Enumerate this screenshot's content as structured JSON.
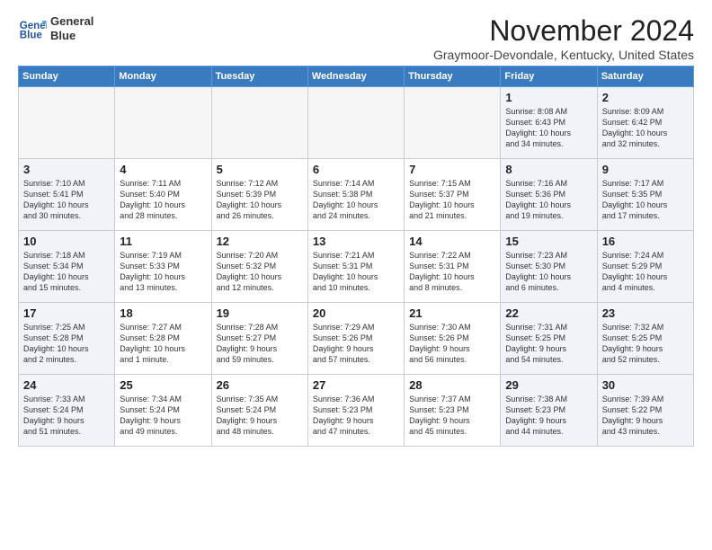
{
  "header": {
    "logo_line1": "General",
    "logo_line2": "Blue",
    "month_title": "November 2024",
    "subtitle": "Graymoor-Devondale, Kentucky, United States"
  },
  "weekdays": [
    "Sunday",
    "Monday",
    "Tuesday",
    "Wednesday",
    "Thursday",
    "Friday",
    "Saturday"
  ],
  "weeks": [
    [
      {
        "day": "",
        "info": "",
        "empty": true
      },
      {
        "day": "",
        "info": "",
        "empty": true
      },
      {
        "day": "",
        "info": "",
        "empty": true
      },
      {
        "day": "",
        "info": "",
        "empty": true
      },
      {
        "day": "",
        "info": "",
        "empty": true
      },
      {
        "day": "1",
        "info": "Sunrise: 8:08 AM\nSunset: 6:43 PM\nDaylight: 10 hours\nand 34 minutes.",
        "empty": false,
        "weekend": true
      },
      {
        "day": "2",
        "info": "Sunrise: 8:09 AM\nSunset: 6:42 PM\nDaylight: 10 hours\nand 32 minutes.",
        "empty": false,
        "weekend": true
      }
    ],
    [
      {
        "day": "3",
        "info": "Sunrise: 7:10 AM\nSunset: 5:41 PM\nDaylight: 10 hours\nand 30 minutes.",
        "empty": false,
        "weekend": true
      },
      {
        "day": "4",
        "info": "Sunrise: 7:11 AM\nSunset: 5:40 PM\nDaylight: 10 hours\nand 28 minutes.",
        "empty": false
      },
      {
        "day": "5",
        "info": "Sunrise: 7:12 AM\nSunset: 5:39 PM\nDaylight: 10 hours\nand 26 minutes.",
        "empty": false
      },
      {
        "day": "6",
        "info": "Sunrise: 7:14 AM\nSunset: 5:38 PM\nDaylight: 10 hours\nand 24 minutes.",
        "empty": false
      },
      {
        "day": "7",
        "info": "Sunrise: 7:15 AM\nSunset: 5:37 PM\nDaylight: 10 hours\nand 21 minutes.",
        "empty": false
      },
      {
        "day": "8",
        "info": "Sunrise: 7:16 AM\nSunset: 5:36 PM\nDaylight: 10 hours\nand 19 minutes.",
        "empty": false,
        "weekend": true
      },
      {
        "day": "9",
        "info": "Sunrise: 7:17 AM\nSunset: 5:35 PM\nDaylight: 10 hours\nand 17 minutes.",
        "empty": false,
        "weekend": true
      }
    ],
    [
      {
        "day": "10",
        "info": "Sunrise: 7:18 AM\nSunset: 5:34 PM\nDaylight: 10 hours\nand 15 minutes.",
        "empty": false,
        "weekend": true
      },
      {
        "day": "11",
        "info": "Sunrise: 7:19 AM\nSunset: 5:33 PM\nDaylight: 10 hours\nand 13 minutes.",
        "empty": false
      },
      {
        "day": "12",
        "info": "Sunrise: 7:20 AM\nSunset: 5:32 PM\nDaylight: 10 hours\nand 12 minutes.",
        "empty": false
      },
      {
        "day": "13",
        "info": "Sunrise: 7:21 AM\nSunset: 5:31 PM\nDaylight: 10 hours\nand 10 minutes.",
        "empty": false
      },
      {
        "day": "14",
        "info": "Sunrise: 7:22 AM\nSunset: 5:31 PM\nDaylight: 10 hours\nand 8 minutes.",
        "empty": false
      },
      {
        "day": "15",
        "info": "Sunrise: 7:23 AM\nSunset: 5:30 PM\nDaylight: 10 hours\nand 6 minutes.",
        "empty": false,
        "weekend": true
      },
      {
        "day": "16",
        "info": "Sunrise: 7:24 AM\nSunset: 5:29 PM\nDaylight: 10 hours\nand 4 minutes.",
        "empty": false,
        "weekend": true
      }
    ],
    [
      {
        "day": "17",
        "info": "Sunrise: 7:25 AM\nSunset: 5:28 PM\nDaylight: 10 hours\nand 2 minutes.",
        "empty": false,
        "weekend": true
      },
      {
        "day": "18",
        "info": "Sunrise: 7:27 AM\nSunset: 5:28 PM\nDaylight: 10 hours\nand 1 minute.",
        "empty": false
      },
      {
        "day": "19",
        "info": "Sunrise: 7:28 AM\nSunset: 5:27 PM\nDaylight: 9 hours\nand 59 minutes.",
        "empty": false
      },
      {
        "day": "20",
        "info": "Sunrise: 7:29 AM\nSunset: 5:26 PM\nDaylight: 9 hours\nand 57 minutes.",
        "empty": false
      },
      {
        "day": "21",
        "info": "Sunrise: 7:30 AM\nSunset: 5:26 PM\nDaylight: 9 hours\nand 56 minutes.",
        "empty": false
      },
      {
        "day": "22",
        "info": "Sunrise: 7:31 AM\nSunset: 5:25 PM\nDaylight: 9 hours\nand 54 minutes.",
        "empty": false,
        "weekend": true
      },
      {
        "day": "23",
        "info": "Sunrise: 7:32 AM\nSunset: 5:25 PM\nDaylight: 9 hours\nand 52 minutes.",
        "empty": false,
        "weekend": true
      }
    ],
    [
      {
        "day": "24",
        "info": "Sunrise: 7:33 AM\nSunset: 5:24 PM\nDaylight: 9 hours\nand 51 minutes.",
        "empty": false,
        "weekend": true
      },
      {
        "day": "25",
        "info": "Sunrise: 7:34 AM\nSunset: 5:24 PM\nDaylight: 9 hours\nand 49 minutes.",
        "empty": false
      },
      {
        "day": "26",
        "info": "Sunrise: 7:35 AM\nSunset: 5:24 PM\nDaylight: 9 hours\nand 48 minutes.",
        "empty": false
      },
      {
        "day": "27",
        "info": "Sunrise: 7:36 AM\nSunset: 5:23 PM\nDaylight: 9 hours\nand 47 minutes.",
        "empty": false
      },
      {
        "day": "28",
        "info": "Sunrise: 7:37 AM\nSunset: 5:23 PM\nDaylight: 9 hours\nand 45 minutes.",
        "empty": false
      },
      {
        "day": "29",
        "info": "Sunrise: 7:38 AM\nSunset: 5:23 PM\nDaylight: 9 hours\nand 44 minutes.",
        "empty": false,
        "weekend": true
      },
      {
        "day": "30",
        "info": "Sunrise: 7:39 AM\nSunset: 5:22 PM\nDaylight: 9 hours\nand 43 minutes.",
        "empty": false,
        "weekend": true
      }
    ]
  ]
}
